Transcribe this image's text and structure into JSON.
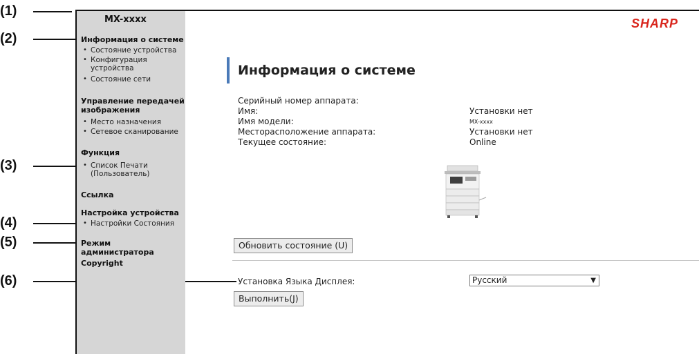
{
  "callouts": [
    "(1)",
    "(2)",
    "(3)",
    "(4)",
    "(5)",
    "(6)"
  ],
  "sidebar": {
    "title": "MX-xxxx",
    "section_system": "Информация о системе",
    "item_device_status": "Состояние устройства",
    "item_device_config_1": "Конфигурация",
    "item_device_config_2": "устройства",
    "item_network_status": "Состояние сети",
    "section_image_send_1": "Управление передачей",
    "section_image_send_2": "изображения",
    "item_destination": "Место назначения",
    "item_network_scan": "Сетевое сканирование",
    "section_function": "Функция",
    "item_print_list_1": "Список Печати",
    "item_print_list_2": "(Пользователь)",
    "section_link": "Ссылка",
    "section_device_settings": "Настройка устройства",
    "item_status_settings": "Настройки Состояния",
    "section_admin_mode": "Режим администратора",
    "section_copyright": "Copyright"
  },
  "brand": {
    "logo_text": "SHARP",
    "logo_color": "#d9251c"
  },
  "main": {
    "heading": "Информация о системе",
    "serial_label": "Серийный номер аппарата:",
    "name_label": "Имя:",
    "name_value": "Установки нет",
    "model_label": "Имя модели:",
    "model_value": "MX-xxxx",
    "location_label": "Месторасположение аппарата:",
    "location_value": "Установки нет",
    "current_status_label": "Текущее состояние:",
    "current_status_value": "Online",
    "refresh_button": "Обновить состояние (U)",
    "language_label": "Установка Языка Дисплея:",
    "language_selected": "Русский",
    "execute_button": "Выполнить(J)"
  },
  "icons": {
    "printer": "printer-icon",
    "dropdown": "chevron-down-icon"
  }
}
